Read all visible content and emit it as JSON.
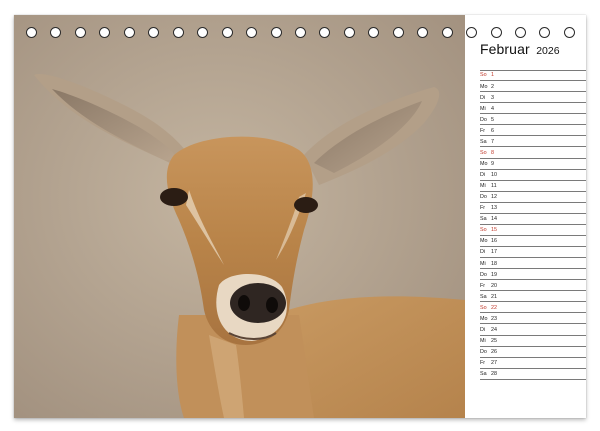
{
  "calendar": {
    "month": "Februar",
    "year": "2026",
    "sunday_color": "#c0392b",
    "days": [
      {
        "dn": "So",
        "d": "1",
        "sunday": true
      },
      {
        "dn": "Mo",
        "d": "2"
      },
      {
        "dn": "Di",
        "d": "3"
      },
      {
        "dn": "Mi",
        "d": "4"
      },
      {
        "dn": "Do",
        "d": "5"
      },
      {
        "dn": "Fr",
        "d": "6"
      },
      {
        "dn": "Sa",
        "d": "7"
      },
      {
        "dn": "So",
        "d": "8",
        "sunday": true
      },
      {
        "dn": "Mo",
        "d": "9"
      },
      {
        "dn": "Di",
        "d": "10"
      },
      {
        "dn": "Mi",
        "d": "11"
      },
      {
        "dn": "Do",
        "d": "12"
      },
      {
        "dn": "Fr",
        "d": "13"
      },
      {
        "dn": "Sa",
        "d": "14"
      },
      {
        "dn": "So",
        "d": "15",
        "sunday": true
      },
      {
        "dn": "Mo",
        "d": "16"
      },
      {
        "dn": "Di",
        "d": "17"
      },
      {
        "dn": "Mi",
        "d": "18"
      },
      {
        "dn": "Do",
        "d": "19"
      },
      {
        "dn": "Fr",
        "d": "20"
      },
      {
        "dn": "Sa",
        "d": "21"
      },
      {
        "dn": "So",
        "d": "22",
        "sunday": true
      },
      {
        "dn": "Mo",
        "d": "23"
      },
      {
        "dn": "Di",
        "d": "24"
      },
      {
        "dn": "Mi",
        "d": "25"
      },
      {
        "dn": "Do",
        "d": "26"
      },
      {
        "dn": "Fr",
        "d": "27"
      },
      {
        "dn": "Sa",
        "d": "28"
      }
    ]
  },
  "binding": {
    "hole_count": 23
  },
  "photo": {
    "subject_icon": "antelope-head-photo"
  }
}
